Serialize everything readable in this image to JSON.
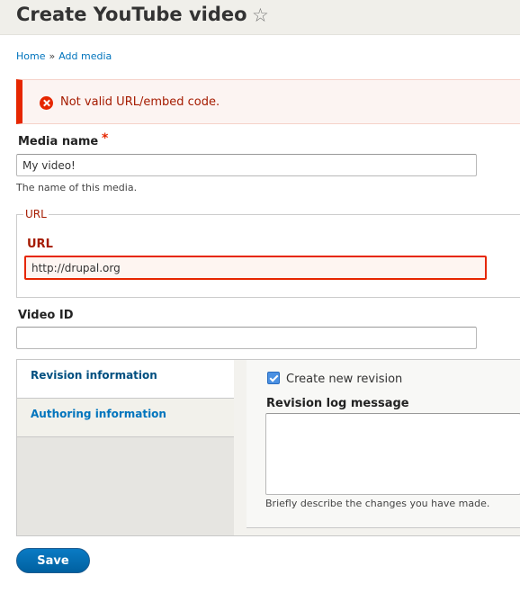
{
  "header": {
    "title": "Create YouTube video"
  },
  "breadcrumb": {
    "items": [
      "Home",
      "Add media"
    ],
    "separator": "»"
  },
  "messages": {
    "error": "Not valid URL/embed code."
  },
  "form": {
    "media_name": {
      "label": "Media name",
      "required_marker": "*",
      "value": "My video!",
      "description": "The name of this media."
    },
    "url_fieldset": {
      "legend": "URL",
      "label": "URL",
      "value": "http://drupal.org"
    },
    "video_id": {
      "label": "Video ID",
      "value": ""
    },
    "vertical_tabs": {
      "tabs": [
        {
          "label": "Revision information",
          "active": true
        },
        {
          "label": "Authoring information",
          "active": false
        }
      ],
      "create_revision_label": "Create new revision",
      "create_revision_checked": true,
      "revision_log_label": "Revision log message",
      "revision_log_value": "",
      "revision_log_description": "Briefly describe the changes you have made."
    },
    "save_label": "Save"
  },
  "colors": {
    "error": "#e62600",
    "link": "#0074bd",
    "primary_button": "#0071b8"
  }
}
